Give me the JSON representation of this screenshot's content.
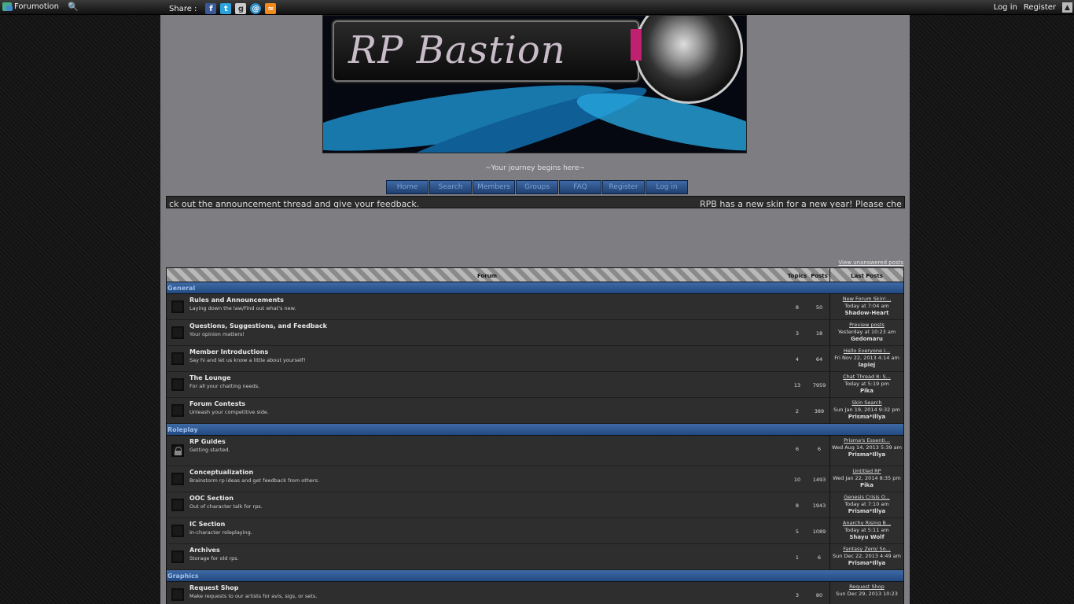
{
  "topbar": {
    "brand": "Forumotion",
    "share_label": "Share :",
    "login": "Log in",
    "register": "Register"
  },
  "banner": {
    "title": "RP Bastion"
  },
  "tagline": "~Your journey begins here~",
  "nav": [
    "Home",
    "Search",
    "Members",
    "Groups",
    "FAQ",
    "Register",
    "Log in"
  ],
  "ticker": {
    "part1": "ck out the announcement thread and give your feedback.",
    "part2": "RPB has a new skin for a new year! Please che"
  },
  "unanswered": "View unanswered posts",
  "table_header": {
    "forum": "Forum",
    "topics": "Topics",
    "posts": "Posts",
    "last": "Last Posts"
  },
  "categories": [
    {
      "name": "General",
      "forums": [
        {
          "title": "Rules and Announcements",
          "desc": "Laying down the law/Find out what's new.",
          "topics": "8",
          "posts": "50",
          "last_title": "New Forum Skin!...",
          "last_date": "Today at 7:04 am",
          "last_user": "Shadow-Heart"
        },
        {
          "title": "Questions, Suggestions, and Feedback",
          "desc": "Your opinion matters!",
          "topics": "3",
          "posts": "18",
          "last_title": "Preview posts",
          "last_date": "Yesterday at 10:23 am",
          "last_user": "Gedomaru"
        },
        {
          "title": "Member Introductions",
          "desc": "Say hi and let us know a little about yourself!",
          "topics": "4",
          "posts": "64",
          "last_title": "Hello Everyone I...",
          "last_date": "Fri Nov 22, 2013 4:14 am",
          "last_user": "lapiej"
        },
        {
          "title": "The Lounge",
          "desc": "For all your chatting needs.",
          "topics": "13",
          "posts": "7959",
          "last_title": "Chat Thread 8: S...",
          "last_date": "Today at 5:19 pm",
          "last_user": "Pika"
        },
        {
          "title": "Forum Contests",
          "desc": "Unleash your competitive side.",
          "topics": "2",
          "posts": "389",
          "last_title": "Skin Search",
          "last_date": "Sun Jan 19, 2014 9:32 pm",
          "last_user": "Prisma*Illya"
        }
      ]
    },
    {
      "name": "Roleplay",
      "forums": [
        {
          "title": "RP Guides",
          "desc": "Getting started.",
          "topics": "6",
          "posts": "6",
          "last_title": "Prisma's Essenti...",
          "last_date": "Wed Aug 14, 2013 5:39 am",
          "last_user": "Prisma*Illya",
          "locked": true
        },
        {
          "title": "Conceptualization",
          "desc": "Brainstorm rp ideas and get feedback from others.",
          "topics": "10",
          "posts": "1493",
          "last_title": "Untitled RP",
          "last_date": "Wed Jan 22, 2014 8:35 pm",
          "last_user": "Pika"
        },
        {
          "title": "OOC Section",
          "desc": "Out of character talk for rps.",
          "topics": "8",
          "posts": "1943",
          "last_title": "Genesis Crisis O...",
          "last_date": "Today at 7:10 am",
          "last_user": "Prisma*Illya"
        },
        {
          "title": "IC Section",
          "desc": "In-character roleplaying.",
          "topics": "5",
          "posts": "1089",
          "last_title": "Anarchy Rising B...",
          "last_date": "Today at 5:11 am",
          "last_user": "Shayu Wolf"
        },
        {
          "title": "Archives",
          "desc": "Storage for old rps.",
          "topics": "1",
          "posts": "6",
          "last_title": "Fantasy Zero/ So...",
          "last_date": "Sun Dec 22, 2013 4:49 am",
          "last_user": "Prisma*Illya"
        }
      ]
    },
    {
      "name": "Graphics",
      "forums": [
        {
          "title": "Request Shop",
          "desc": "Make requests to our artists for avis, sigs, or sets.",
          "topics": "3",
          "posts": "80",
          "last_title": "Request Shop",
          "last_date": "Sun Dec 29, 2013 10:23",
          "last_user": ""
        }
      ]
    }
  ],
  "colors": {
    "accent": "#2f5a95",
    "page_bg": "#7e7e82",
    "cat_text": "#9fc0ec"
  }
}
